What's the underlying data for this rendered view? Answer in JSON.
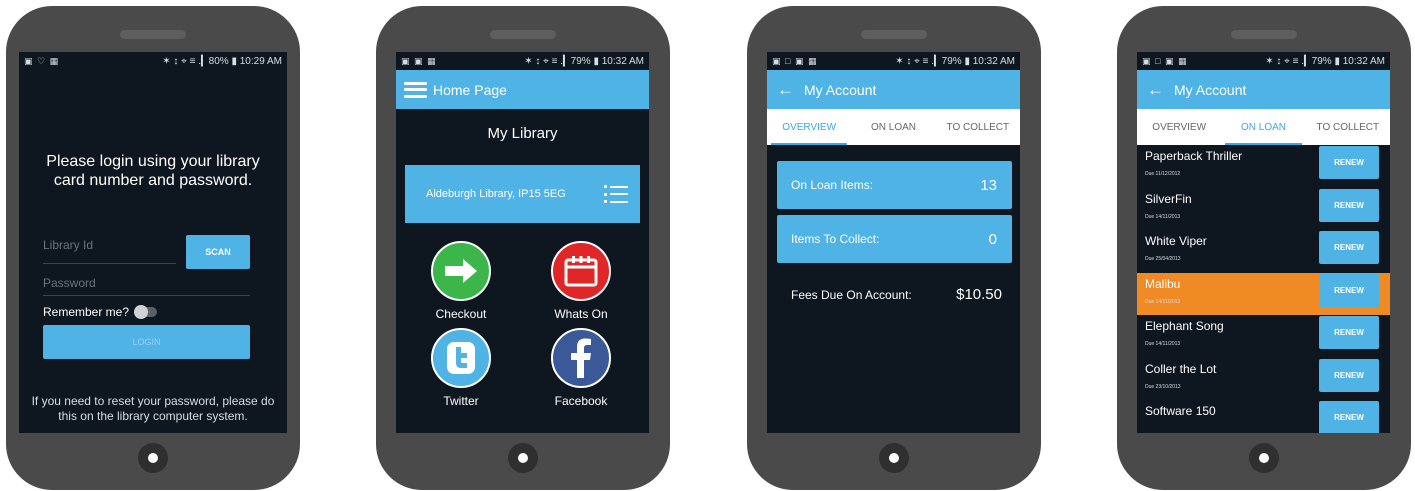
{
  "status": {
    "s1": {
      "notif": "▣ ♡ ▦",
      "right": "✶ ↕ ⌖ ≡ .▎80% ▮ 10:29 AM"
    },
    "s2": {
      "notif": "▣ ▣ ▦",
      "right": "✶ ↕ ⌖ ≡ .▎79% ▮ 10:32 AM"
    },
    "s3": {
      "notif": "▣ □ ▣ ▦",
      "right": "✶ ↕ ⌖ ≡ .▎79% ▮ 10:32 AM"
    },
    "s4": {
      "notif": "▣ □ ▣ ▦",
      "right": "✶ ↕ ⌖ ≡ .▎79% ▮ 10:32 AM"
    }
  },
  "login": {
    "heading": "Please login using your library card number and password.",
    "library_id_placeholder": "Library Id",
    "password_placeholder": "Password",
    "scan_label": "SCAN",
    "remember_label": "Remember me?",
    "login_label": "LOGIN",
    "reset_text": "If you need to reset your password, please do this on the library computer system."
  },
  "home": {
    "title": "Home Page",
    "heading": "My Library",
    "branch": "Aldeburgh Library, IP15 5EG",
    "tiles": [
      {
        "label": "Checkout",
        "icon": "arrow-right-icon",
        "color": "#3cb54a"
      },
      {
        "label": "Whats On",
        "icon": "calendar-icon",
        "color": "#e02626"
      },
      {
        "label": "Twitter",
        "icon": "twitter-icon",
        "color": "#4fb3e6"
      },
      {
        "label": "Facebook",
        "icon": "facebook-icon",
        "color": "#3b5998"
      }
    ]
  },
  "account": {
    "title": "My Account",
    "tabs": [
      "OVERVIEW",
      "ON LOAN",
      "TO COLLECT"
    ],
    "on_loan_label": "On Loan Items:",
    "on_loan_count": "13",
    "to_collect_label": "Items To Collect:",
    "to_collect_count": "0",
    "fees_label": "Fees Due On Account:",
    "fees_amount": "$10.50"
  },
  "loans": {
    "title": "My Account",
    "tabs": [
      "OVERVIEW",
      "ON LOAN",
      "TO COLLECT"
    ],
    "renew_label": "RENEW",
    "items": [
      {
        "title": "Paperback Thriller",
        "due": "Due 11/12/2012"
      },
      {
        "title": "SilverFin",
        "due": "Due 14/11/2013"
      },
      {
        "title": "White Viper",
        "due": "Due 25/04/2013"
      },
      {
        "title": "Malibu",
        "due": "Due 14/11/2013"
      },
      {
        "title": "Elephant Song",
        "due": "Due 14/11/2013"
      },
      {
        "title": "Coller the Lot",
        "due": "Due 23/10/2013"
      },
      {
        "title": "Software 150",
        "due": ""
      }
    ]
  },
  "colors": {
    "accent": "#4fb3e6",
    "highlight": "#f08a24",
    "screen_bg": "#0e1620",
    "phone_body": "#4a4a4a"
  }
}
